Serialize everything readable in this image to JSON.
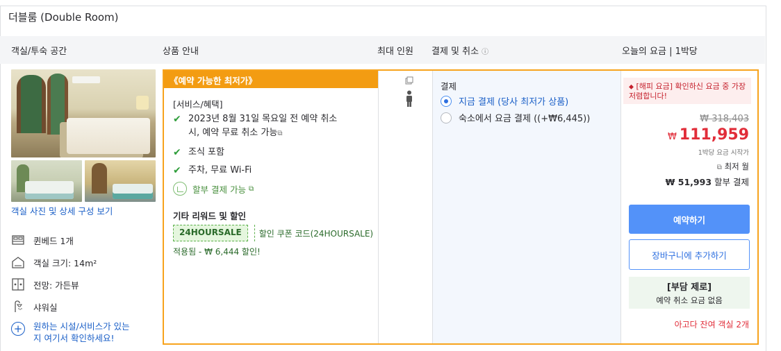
{
  "room": {
    "title": "더블룸 (Double Room)"
  },
  "columns": {
    "room": "객실/투숙 공간",
    "product": "상품 안내",
    "max_guests": "최대 인원",
    "payment": "결제 및 취소",
    "price": "오늘의 요금 | 1박당"
  },
  "left": {
    "photo_link": "객실 사진 및 상세 구성 보기",
    "amenities": [
      {
        "icon": "bed-icon",
        "label": "퀸베드 1개"
      },
      {
        "icon": "room-size-icon",
        "label": "객실 크기: 14m²"
      },
      {
        "icon": "view-icon",
        "label": "전망: 가든뷰"
      },
      {
        "icon": "shower-icon",
        "label": "샤워실"
      }
    ],
    "more_line1": "원하는 시설/서비스가 있는",
    "more_line2": "지 여기서 확인하세요!"
  },
  "offer": {
    "ribbon": "《예약 가능한 최저가》",
    "services_title": "[서비스/혜택]",
    "free_cancel_line1": "2023년 8월 31일 목요일 전 예약 취소",
    "free_cancel_line2": "시, 예약 무료 취소 가능",
    "breakfast": "조식 포함",
    "parking_wifi": "주차, 무료 Wi-Fi",
    "installment": "할부 결제 가능",
    "rewards_title": "기타 리워드 및 할인",
    "coupon_code": "24HOURSALE",
    "coupon_desc": "할인 쿠폰 코드(24HOURSALE)",
    "coupon_applied": "적용됨 - ₩ 6,444 할인!"
  },
  "payment": {
    "title": "결제",
    "options": [
      {
        "label": "지금 결제 (당사 최저가 상품)",
        "selected": true
      },
      {
        "label": "숙소에서 요금 결제 ((+₩6,445))",
        "selected": false
      }
    ]
  },
  "price": {
    "hot_deal": "[해피 요금] 확인하신 요금 중 가장 저렴합니다!",
    "original": "₩ 318,403",
    "currency": "₩",
    "sale": "111,959",
    "per_night": "1박당 요금 시작가",
    "lowest": "최저 월",
    "installment_amount": "₩ 51,993",
    "installment_label": "할부 결제",
    "book_button": "예약하기",
    "cart_button": "장바구니에 추가하기",
    "zero_title": "[부담 제로]",
    "zero_sub": "예약 취소 요금 없음",
    "rooms_left": "아고다 잔여 객실 2개"
  },
  "colors": {
    "accent_orange": "#f7a31c",
    "primary_blue": "#5392f9",
    "sale_red": "#e12d39",
    "green": "#2e9d3a"
  }
}
